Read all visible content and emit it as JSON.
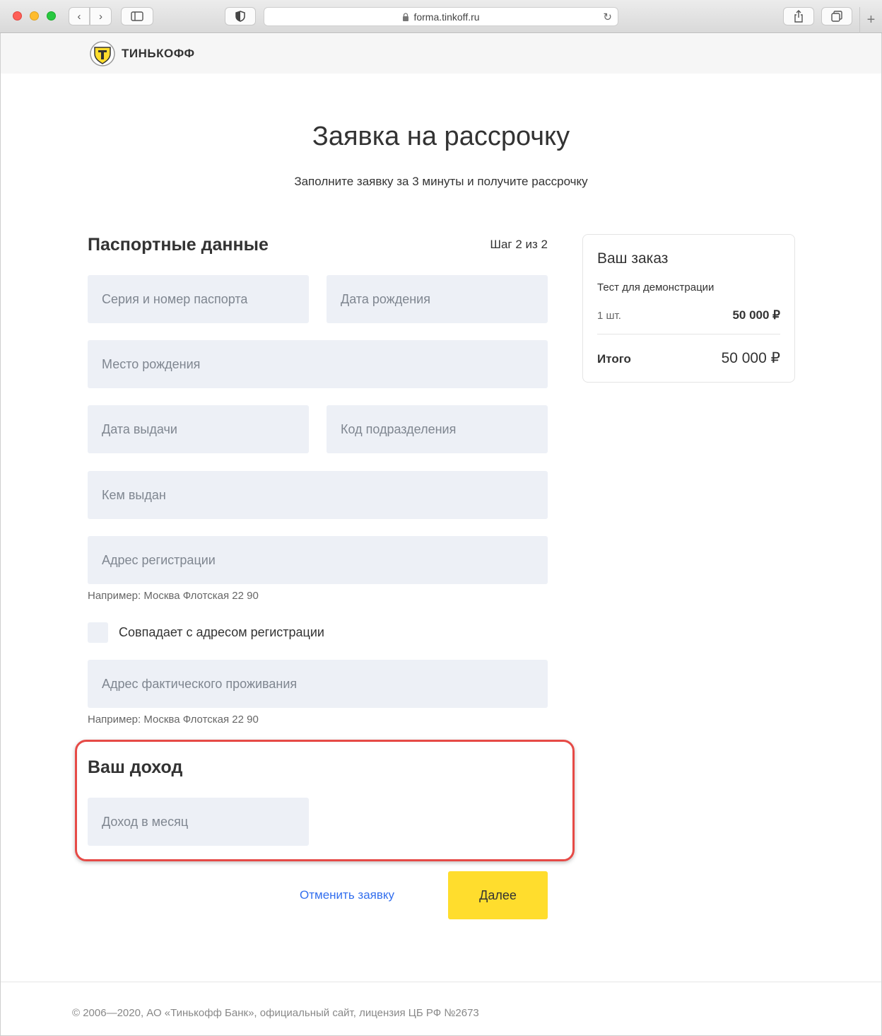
{
  "browser": {
    "url": "forma.tinkoff.ru",
    "nav_back": "‹",
    "nav_forward": "›"
  },
  "header": {
    "brand": "ТИНЬКОФФ"
  },
  "page": {
    "title": "Заявка на рассрочку",
    "subtitle": "Заполните заявку за 3 минуты и получите рассрочку"
  },
  "passport": {
    "title": "Паспортные данные",
    "step": "Шаг 2 из 2",
    "series_placeholder": "Серия и номер паспорта",
    "birthdate_placeholder": "Дата рождения",
    "birthplace_placeholder": "Место рождения",
    "issue_date_placeholder": "Дата выдачи",
    "division_code_placeholder": "Код подразделения",
    "issued_by_placeholder": "Кем выдан",
    "registration_placeholder": "Адрес регистрации",
    "registration_hint": "Например: Москва Флотская 22 90",
    "same_address_label": "Совпадает с адресом регистрации",
    "actual_address_placeholder": "Адрес фактического проживания",
    "actual_address_hint": "Например: Москва Флотская 22 90"
  },
  "income": {
    "title": "Ваш доход",
    "monthly_placeholder": "Доход в месяц"
  },
  "actions": {
    "cancel": "Отменить заявку",
    "next": "Далее"
  },
  "order": {
    "title": "Ваш заказ",
    "item": "Тест для демонстрации",
    "qty": "1 шт.",
    "price": "50 000 ₽",
    "total_label": "Итого",
    "total": "50 000 ₽"
  },
  "footer": {
    "copyright": "© 2006—2020, АО «Тинькофф Банк», официальный сайт, лицензия ЦБ РФ №2673"
  },
  "colors": {
    "accent": "#ffdd2d",
    "link": "#336fee",
    "field_bg": "#edf0f6",
    "highlight": "#e64a46"
  }
}
